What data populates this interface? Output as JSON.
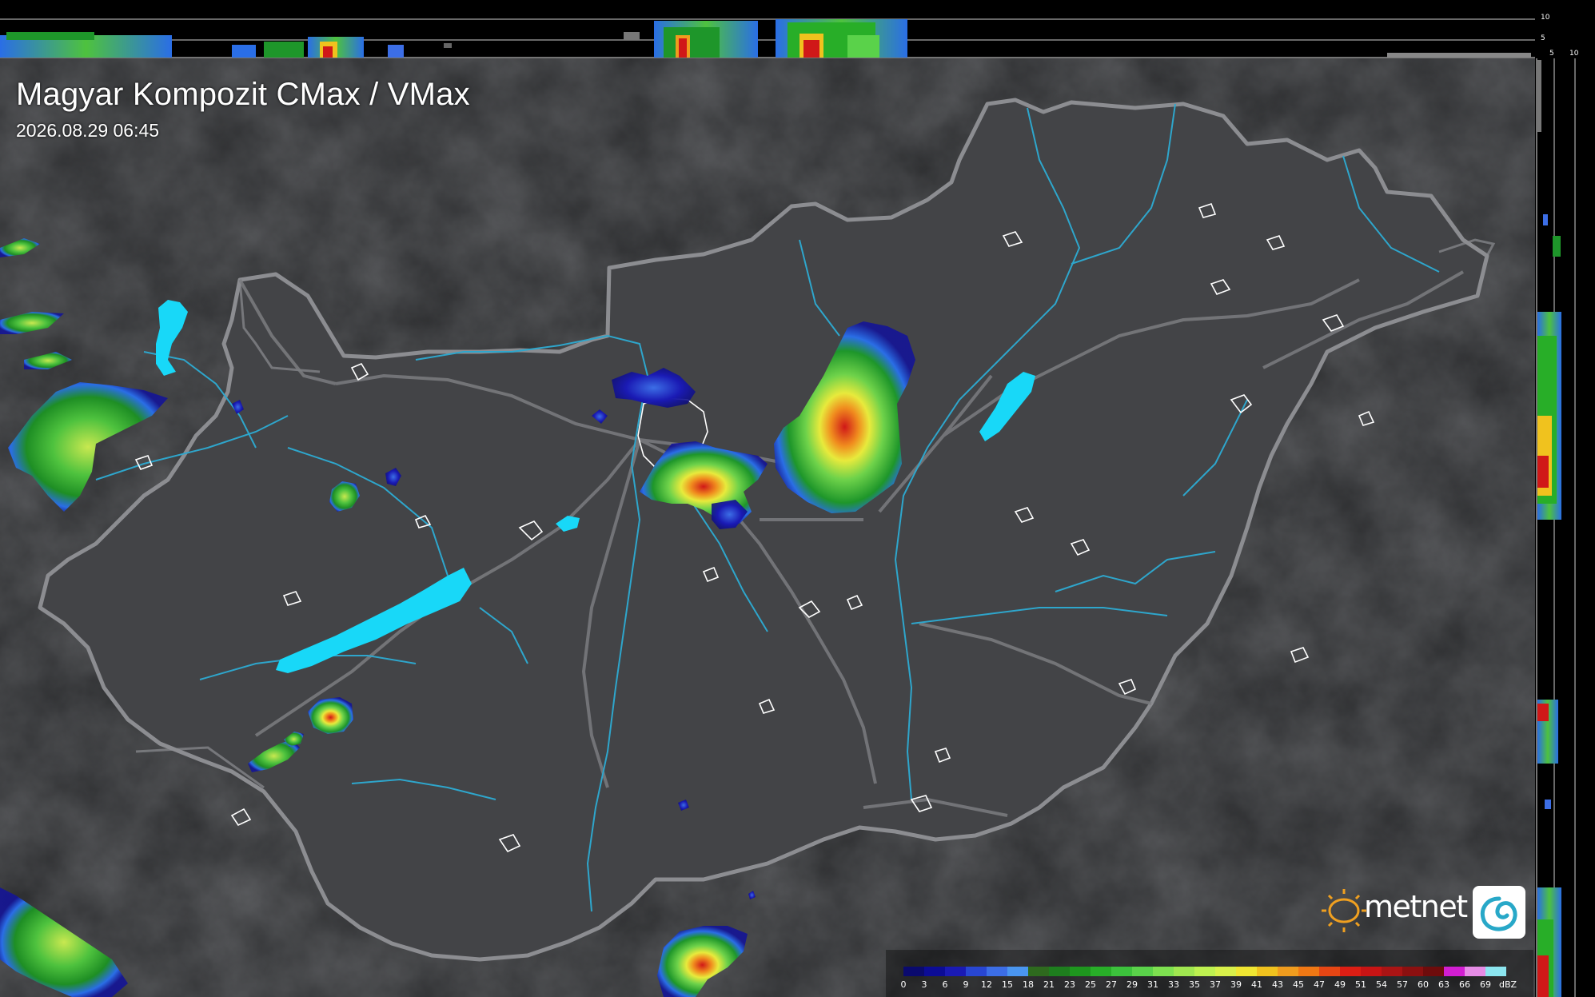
{
  "map": {
    "title": "Magyar Kompozit CMax / VMax",
    "timestamp": "2026.08.29 06:45",
    "brand": "metnet"
  },
  "profile_axes": {
    "top": [
      "10",
      "5"
    ],
    "right": [
      "5",
      "10"
    ]
  },
  "legend": {
    "unit": "dBZ",
    "values": [
      "0",
      "3",
      "6",
      "9",
      "12",
      "15",
      "18",
      "21",
      "23",
      "25",
      "27",
      "29",
      "31",
      "33",
      "35",
      "37",
      "39",
      "41",
      "43",
      "45",
      "47",
      "49",
      "51",
      "54",
      "57",
      "60",
      "63",
      "66",
      "69"
    ],
    "colors": [
      "#0a0a6e",
      "#0c0c96",
      "#1a1ab4",
      "#2846d2",
      "#3c6ee6",
      "#4a96f0",
      "#2e6a1e",
      "#1e7e1e",
      "#1e961e",
      "#28ae28",
      "#3cc23c",
      "#5ad24a",
      "#7ee050",
      "#a0e650",
      "#bef050",
      "#d8f04a",
      "#f0e632",
      "#f0c21e",
      "#f09c1e",
      "#f07814",
      "#e64614",
      "#dc1e14",
      "#c81414",
      "#aa1414",
      "#8c1010",
      "#6e0c0c",
      "#d21ed2",
      "#e68ce6",
      "#8ce6f0"
    ]
  },
  "colors": {
    "background": "#2f3032",
    "country_fill": "#434447",
    "border": "#8c8d91",
    "river": "#2ea6cc",
    "lake": "#18d8f8",
    "city_outline": "#ffffff",
    "logo_sun": "#f0a020",
    "logo_swirl": "#28a8c8"
  }
}
